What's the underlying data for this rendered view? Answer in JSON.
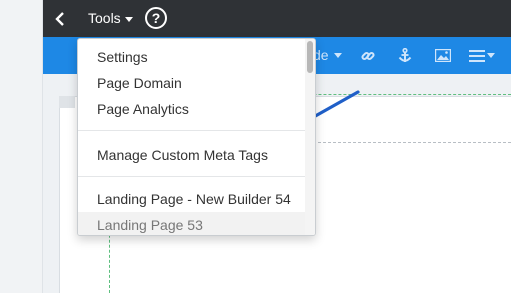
{
  "topbar": {
    "back_icon": "chevron-left-icon",
    "tools_label": "Tools",
    "help_glyph": "?"
  },
  "bluebar": {
    "partial_label": "de",
    "icons": [
      "link-icon",
      "anchor-icon",
      "image-icon",
      "align-icon"
    ]
  },
  "tools_menu": {
    "items": [
      {
        "label": "Settings"
      },
      {
        "label": "Page Domain"
      },
      {
        "label": "Page Analytics"
      },
      {
        "label": "Manage Custom Meta Tags"
      },
      {
        "label": "Landing Page - New Builder 54"
      },
      {
        "label": "Landing Page 53"
      }
    ]
  },
  "colors": {
    "topbar": "#2f3236",
    "bluebar": "#1e88e5",
    "annotation_arrow": "#1f5fc8"
  }
}
